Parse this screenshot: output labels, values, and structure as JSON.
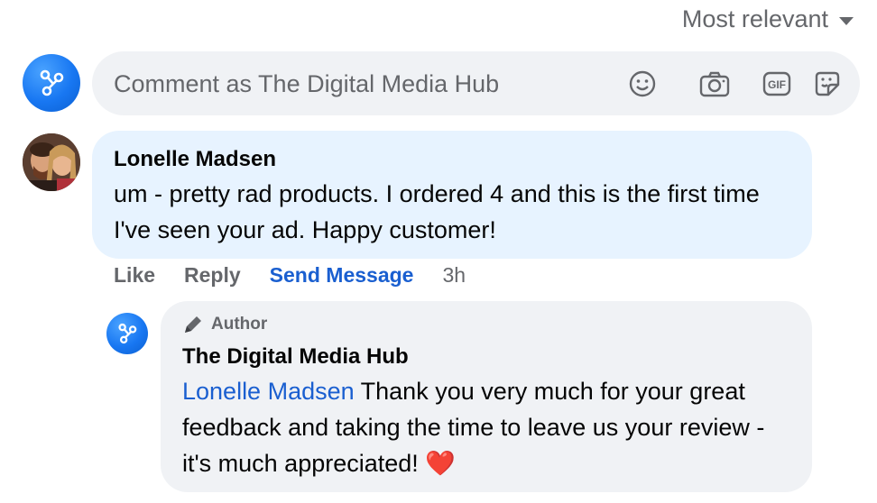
{
  "sort": {
    "label": "Most relevant"
  },
  "composer": {
    "placeholder": "Comment as The Digital Media Hub"
  },
  "comment": {
    "author": "Lonelle Madsen",
    "text": "um - pretty rad products. I ordered 4 and this is the first time I've seen your ad. Happy customer!",
    "actions": {
      "like": "Like",
      "reply": "Reply",
      "send_message": "Send Message",
      "time": "3h"
    }
  },
  "reply": {
    "badge": "Author",
    "author": "The Digital Media Hub",
    "mention": "Lonelle Madsen",
    "text": " Thank you very much for your great feedback and taking the time to leave us your review - it's much appreciated! ❤️"
  },
  "colors": {
    "accent": "#1a5fd0",
    "bubble": "#f0f2f5",
    "highlight_bubble": "#e7f3ff",
    "secondary_text": "#65676b"
  }
}
